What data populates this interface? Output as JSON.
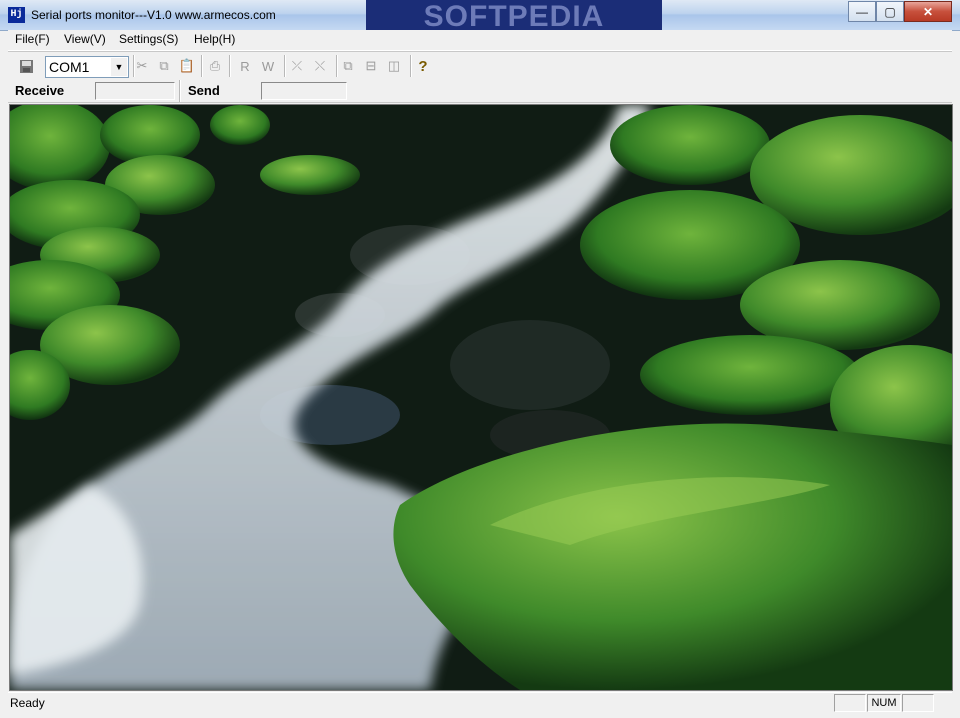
{
  "window": {
    "title": "Serial ports monitor---V1.0   www.armecos.com",
    "icon_text": "Hj",
    "watermark": "SOFTPEDIA",
    "buttons": {
      "minimize": "—",
      "maximize": "▢",
      "close": "✕"
    }
  },
  "menu": {
    "items": [
      "File(F)",
      "View(V)",
      "Settings(S)",
      "Help(H)"
    ]
  },
  "toolbar": {
    "port_value": "COM1",
    "icons": [
      "save-icon",
      "cut-icon",
      "copy-icon",
      "paste-icon",
      "print-icon",
      "read-icon",
      "write-icon",
      "split-icon",
      "merge-icon",
      "cascade-icon",
      "tile-horizontal-icon",
      "tile-vertical-icon",
      "help-icon"
    ],
    "read_label": "R",
    "write_label": "W",
    "help_label": "?"
  },
  "io": {
    "receive_label": "Receive",
    "send_label": "Send",
    "receive_value": "",
    "send_value": ""
  },
  "statusbar": {
    "text": "Ready",
    "num": "NUM"
  },
  "colors": {
    "moss": "#3f8a2a",
    "water": "#c9d4dc",
    "rock": "#1d2a22"
  }
}
